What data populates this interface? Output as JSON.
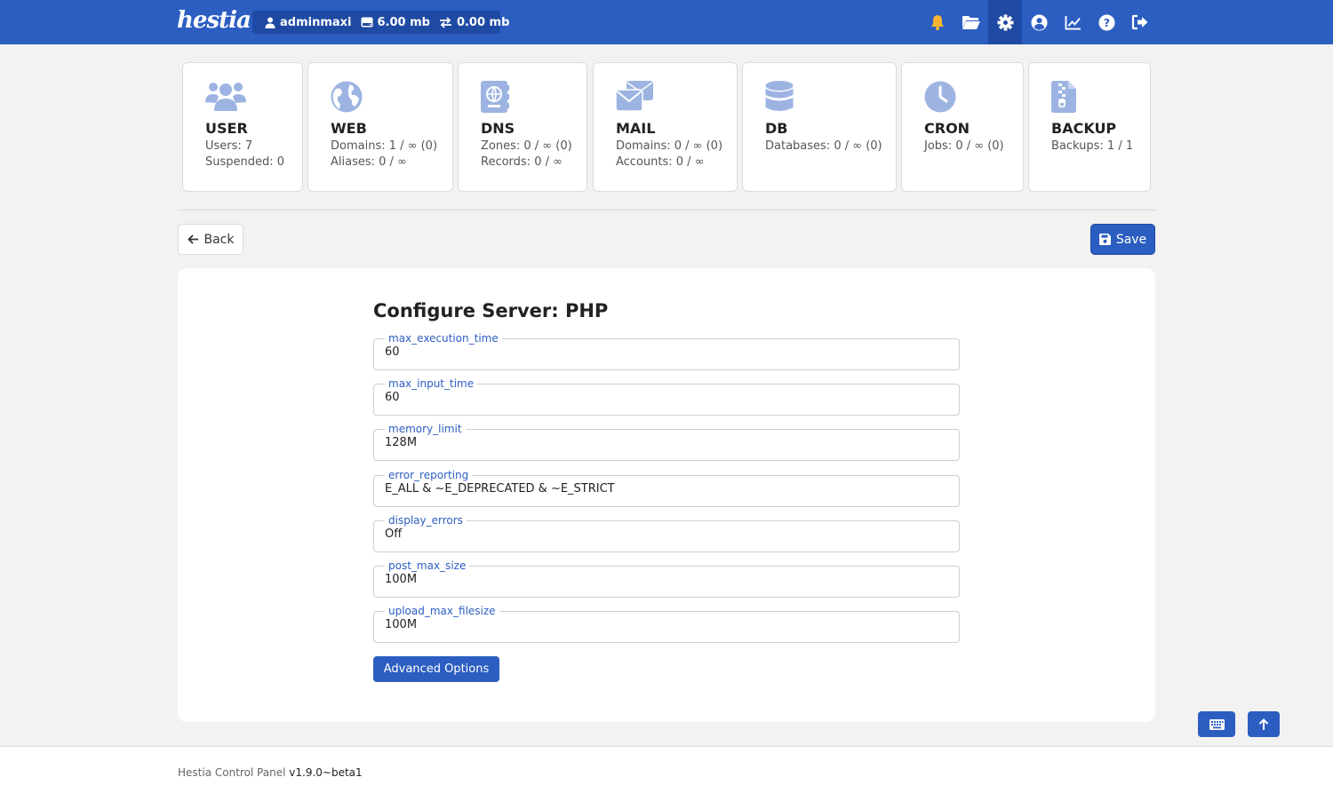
{
  "header": {
    "logo": "hestia",
    "username": "adminmaxi",
    "disk_usage": "6.00 mb",
    "bandwidth": "0.00 mb",
    "icons": [
      "bell-icon",
      "folder-icon",
      "gear-icon",
      "user-circle-icon",
      "chart-icon",
      "help-icon",
      "logout-icon"
    ]
  },
  "cards": [
    {
      "title": "USER",
      "line1": "Users: 7",
      "line2": "Suspended: 0",
      "icon": "users-icon"
    },
    {
      "title": "WEB",
      "line1": "Domains: 1 / ∞ (0)",
      "line2": "Aliases: 0 / ∞",
      "icon": "globe-icon"
    },
    {
      "title": "DNS",
      "line1": "Zones: 0 / ∞ (0)",
      "line2": "Records: 0 / ∞",
      "icon": "address-book-icon"
    },
    {
      "title": "MAIL",
      "line1": "Domains: 0 / ∞ (0)",
      "line2": "Accounts: 0 / ∞",
      "icon": "envelopes-icon"
    },
    {
      "title": "DB",
      "line1": "Databases: 0 / ∞ (0)",
      "line2": "",
      "icon": "database-icon"
    },
    {
      "title": "CRON",
      "line1": "Jobs: 0 / ∞ (0)",
      "line2": "",
      "icon": "clock-icon"
    },
    {
      "title": "BACKUP",
      "line1": "Backups: 1 / 1",
      "line2": "",
      "icon": "file-zipper-icon"
    }
  ],
  "toolbar": {
    "back_label": "Back",
    "save_label": "Save"
  },
  "form": {
    "title": "Configure Server: PHP",
    "fields": [
      {
        "label": "max_execution_time",
        "value": "60"
      },
      {
        "label": "max_input_time",
        "value": "60"
      },
      {
        "label": "memory_limit",
        "value": "128M"
      },
      {
        "label": "error_reporting",
        "value": "E_ALL & ~E_DEPRECATED & ~E_STRICT"
      },
      {
        "label": "display_errors",
        "value": "Off"
      },
      {
        "label": "post_max_size",
        "value": "100M"
      },
      {
        "label": "upload_max_filesize",
        "value": "100M"
      }
    ],
    "advanced_label": "Advanced Options"
  },
  "footer": {
    "brand": "Hestia Control Panel",
    "version": "v1.9.0~beta1"
  },
  "colors": {
    "primary": "#2c5ec1",
    "primary_dark": "#1f4aa3",
    "card_icon": "#9db4e2",
    "bell": "#f5b531"
  }
}
